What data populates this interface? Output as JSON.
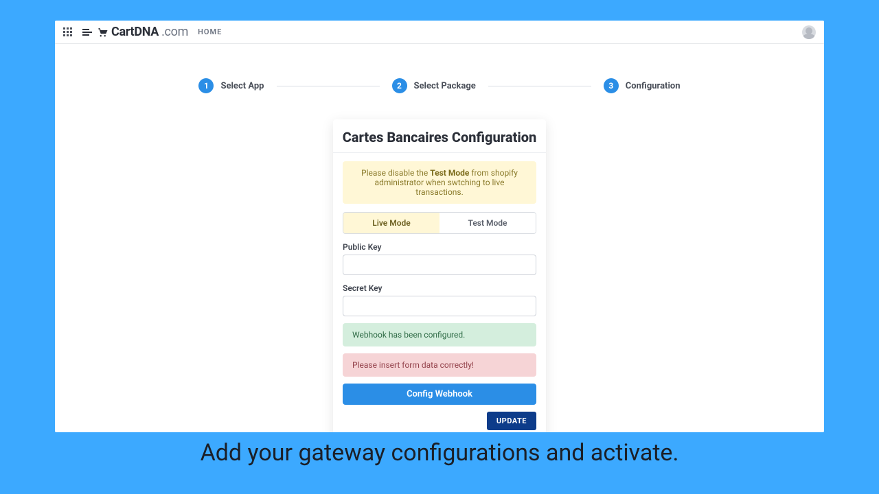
{
  "header": {
    "brand_prefix": "CartDNA",
    "brand_suffix": ".com",
    "home_label": "HOME"
  },
  "stepper": {
    "steps": [
      {
        "num": "1",
        "label": "Select App"
      },
      {
        "num": "2",
        "label": "Select Package"
      },
      {
        "num": "3",
        "label": "Configuration"
      }
    ]
  },
  "card": {
    "title": "Cartes Bancaires Configuration",
    "warning_pre": "Please disable the ",
    "warning_bold": "Test Mode",
    "warning_post": " from shopify administrator when swtching to live transactions.",
    "mode_live": "Live Mode",
    "mode_test": "Test Mode",
    "public_key_label": "Public Key",
    "public_key_value": "",
    "secret_key_label": "Secret Key",
    "secret_key_value": "",
    "success_msg": "Webhook has been configured.",
    "error_msg": "Please insert form data correctly!",
    "config_webhook_label": "Config Webhook",
    "update_label": "UPDATE"
  },
  "caption": "Add your gateway configurations and activate."
}
